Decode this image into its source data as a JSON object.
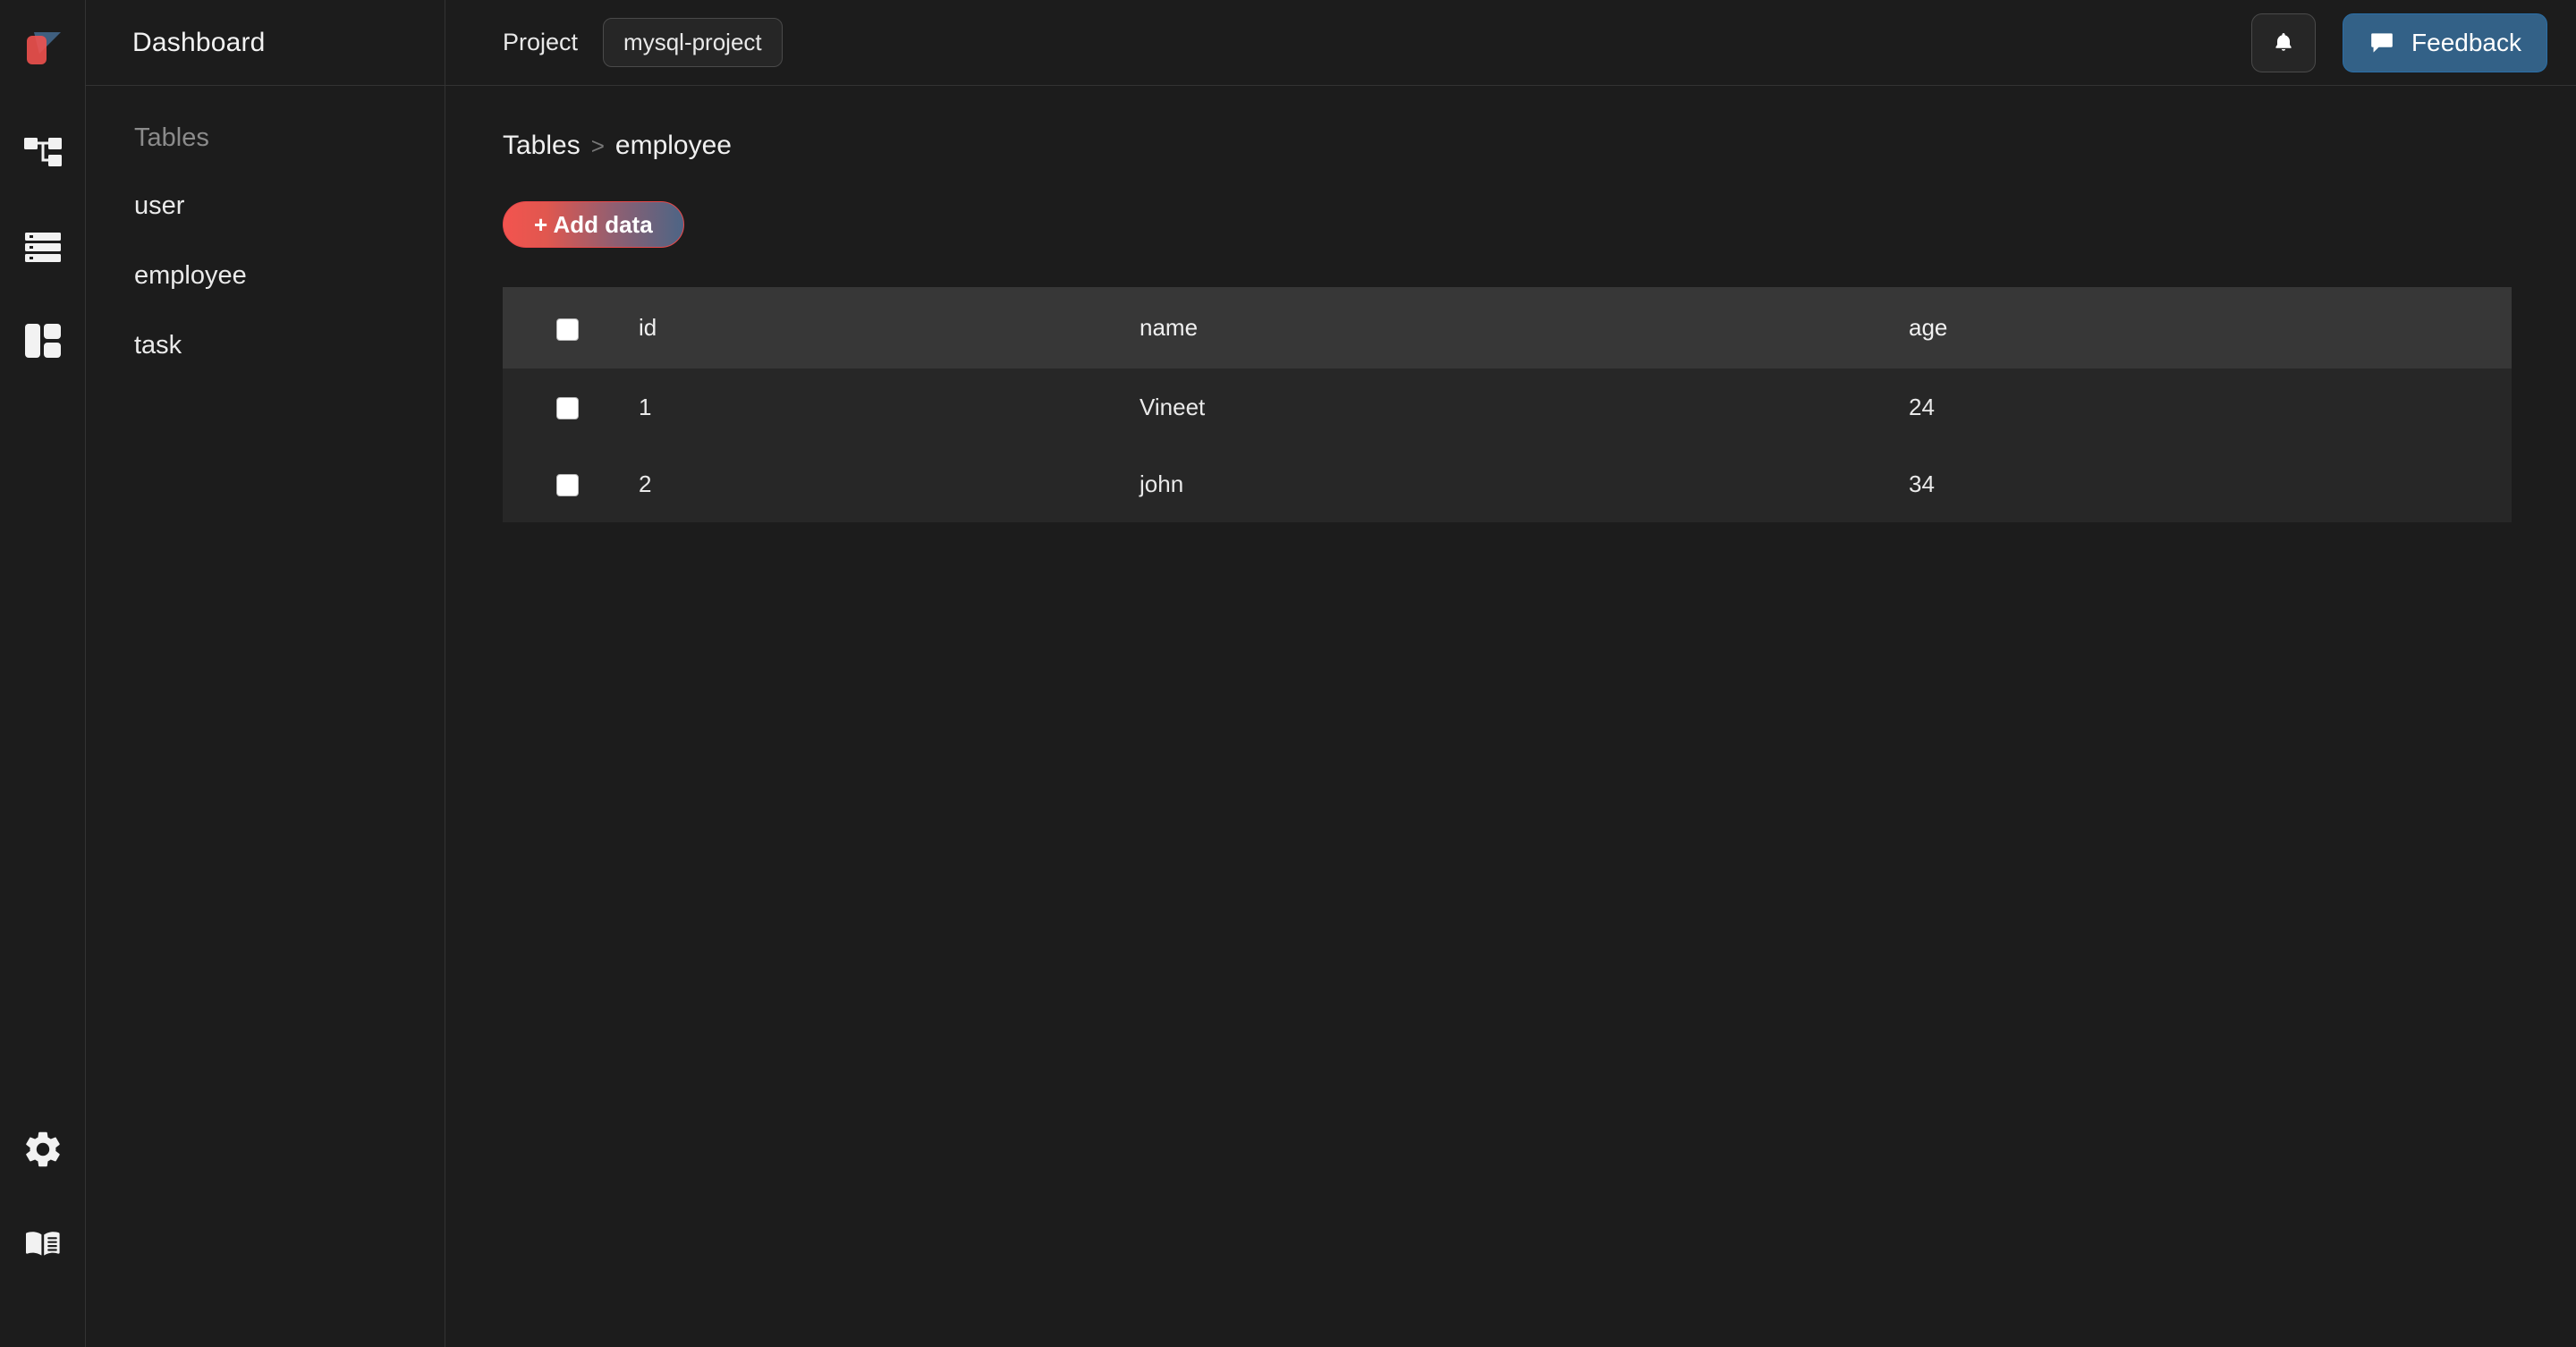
{
  "app": {
    "logo_icon": "flag-logo-icon",
    "background": "#1c1c1c"
  },
  "icon_rail": {
    "items": [
      {
        "name": "schema-icon",
        "label": "Schema"
      },
      {
        "name": "database-icon",
        "label": "Database"
      },
      {
        "name": "layout-icon",
        "label": "Layout"
      }
    ],
    "bottom_items": [
      {
        "name": "gear-icon",
        "label": "Settings"
      },
      {
        "name": "book-icon",
        "label": "Docs"
      }
    ]
  },
  "sidebar": {
    "title": "Dashboard",
    "section_label": "Tables",
    "items": [
      {
        "label": "user"
      },
      {
        "label": "employee"
      },
      {
        "label": "task"
      }
    ]
  },
  "topbar": {
    "project_label": "Project",
    "project_name": "mysql-project",
    "bell_icon": "bell-icon",
    "feedback_label": "Feedback",
    "feedback_icon": "chat-bubble-icon",
    "feedback_color": "#336187"
  },
  "content": {
    "breadcrumb": {
      "root": "Tables",
      "separator": ">",
      "current": "employee"
    },
    "add_data_label": "+ Add data",
    "add_data_gradient_from": "#f3544f",
    "add_data_gradient_to": "#4d6585",
    "table": {
      "columns": [
        "id",
        "name",
        "age"
      ],
      "rows": [
        {
          "id": "1",
          "name": "Vineet",
          "age": "24"
        },
        {
          "id": "2",
          "name": "john",
          "age": "34"
        }
      ],
      "header_bg": "#373737",
      "row_bg": "#272727"
    }
  }
}
